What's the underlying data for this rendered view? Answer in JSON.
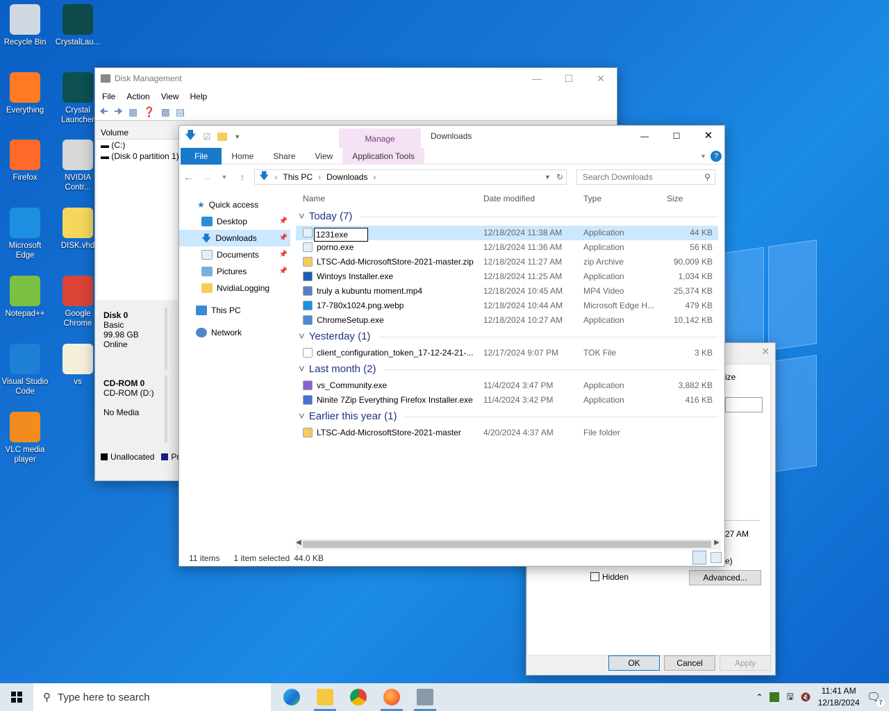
{
  "desktop": {
    "icons": [
      {
        "label": "Recycle Bin"
      },
      {
        "label": "CrystalLau..."
      },
      {
        "label": "Everything"
      },
      {
        "label": "Crystal Launcher"
      },
      {
        "label": "Firefox"
      },
      {
        "label": "NVIDIA Contr..."
      },
      {
        "label": "Microsoft Edge"
      },
      {
        "label": "DISK.vhd"
      },
      {
        "label": "Notepad++"
      },
      {
        "label": "Google Chrome"
      },
      {
        "label": "Visual Studio Code"
      },
      {
        "label": "vs"
      },
      {
        "label": "VLC media player"
      }
    ]
  },
  "disk_management": {
    "title": "Disk Management",
    "menu": [
      "File",
      "Action",
      "View",
      "Help"
    ],
    "volume_header": "Volume",
    "volumes": [
      "(C:)",
      "(Disk 0 partition 1)"
    ],
    "disk0": {
      "name": "Disk 0",
      "type": "Basic",
      "size": "99.98 GB",
      "status": "Online"
    },
    "cdrom": {
      "name": "CD-ROM 0",
      "drive": "CD-ROM (D:)",
      "media": "No Media"
    },
    "legend": {
      "unallocated": "Unallocated",
      "primary": "Pri"
    }
  },
  "properties_dialog": {
    "partial_label_1": "ize",
    "partial_time": "27 AM",
    "partial_label_2": "e)",
    "hidden_label": "Hidden",
    "advanced_label": "Advanced...",
    "ok": "OK",
    "cancel": "Cancel",
    "apply": "Apply"
  },
  "explorer": {
    "title": "Downloads",
    "manage_tab": "Manage",
    "tabs": {
      "file": "File",
      "home": "Home",
      "share": "Share",
      "view": "View",
      "app_tools": "Application Tools"
    },
    "breadcrumb": [
      "This PC",
      "Downloads"
    ],
    "search_placeholder": "Search Downloads",
    "nav": {
      "quick_access": "Quick access",
      "items": [
        "Desktop",
        "Downloads",
        "Documents",
        "Pictures",
        "NvidiaLogging"
      ],
      "this_pc": "This PC",
      "network": "Network"
    },
    "columns": {
      "name": "Name",
      "date": "Date modified",
      "type": "Type",
      "size": "Size"
    },
    "groups": [
      {
        "label": "Today (7)",
        "files": [
          {
            "name": "1231exe",
            "date": "12/18/2024 11:38 AM",
            "type": "Application",
            "size": "44 KB"
          },
          {
            "name": "porno.exe",
            "date": "12/18/2024 11:36 AM",
            "type": "Application",
            "size": "56 KB"
          },
          {
            "name": "LTSC-Add-MicrosoftStore-2021-master.zip",
            "date": "12/18/2024 11:27 AM",
            "type": "zip Archive",
            "size": "90,009 KB"
          },
          {
            "name": "Wintoys Installer.exe",
            "date": "12/18/2024 11:25 AM",
            "type": "Application",
            "size": "1,034 KB"
          },
          {
            "name": "truly a kubuntu moment.mp4",
            "date": "12/18/2024 10:45 AM",
            "type": "MP4 Video",
            "size": "25,374 KB"
          },
          {
            "name": "17-780x1024.png.webp",
            "date": "12/18/2024 10:44 AM",
            "type": "Microsoft Edge H...",
            "size": "479 KB"
          },
          {
            "name": "ChromeSetup.exe",
            "date": "12/18/2024 10:27 AM",
            "type": "Application",
            "size": "10,142 KB"
          }
        ]
      },
      {
        "label": "Yesterday (1)",
        "files": [
          {
            "name": "client_configuration_token_17-12-24-21-...",
            "date": "12/17/2024 9:07 PM",
            "type": "TOK File",
            "size": "3 KB"
          }
        ]
      },
      {
        "label": "Last month (2)",
        "files": [
          {
            "name": "vs_Community.exe",
            "date": "11/4/2024 3:47 PM",
            "type": "Application",
            "size": "3,882 KB"
          },
          {
            "name": "Ninite 7Zip Everything Firefox Installer.exe",
            "date": "11/4/2024 3:42 PM",
            "type": "Application",
            "size": "416 KB"
          }
        ]
      },
      {
        "label": "Earlier this year (1)",
        "files": [
          {
            "name": "LTSC-Add-MicrosoftStore-2021-master",
            "date": "4/20/2024 4:37 AM",
            "type": "File folder",
            "size": ""
          }
        ]
      }
    ],
    "status": {
      "count": "11 items",
      "selected": "1 item selected",
      "sel_size": "44.0 KB"
    }
  },
  "taskbar": {
    "search_placeholder": "Type here to search",
    "time": "11:41 AM",
    "date": "12/18/2024",
    "notification_count": "7"
  }
}
